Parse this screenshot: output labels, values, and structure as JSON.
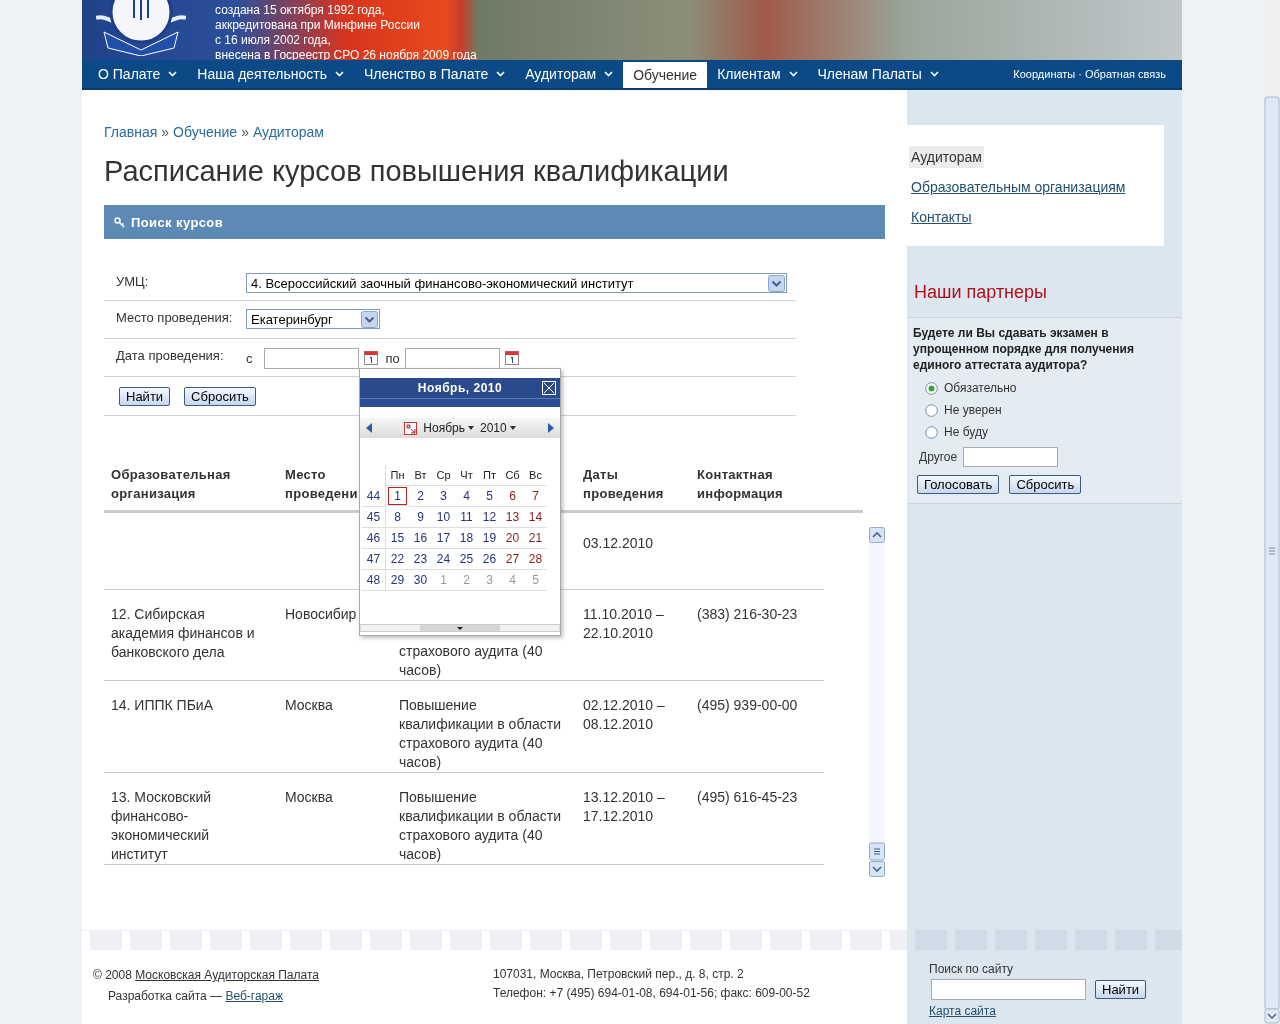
{
  "header": {
    "banner_lines": [
      "создана 15 октября 1992 года,",
      "аккредитована при Минфине России",
      "с 16 июля 2002 года,",
      "внесена в Госреестр СРО 26 ноября 2009 года"
    ]
  },
  "nav": {
    "items": [
      {
        "label": "О Палате",
        "selected": false,
        "dropdown": true
      },
      {
        "label": "Наша деятельность",
        "selected": false,
        "dropdown": true
      },
      {
        "label": "Членство в Палате",
        "selected": false,
        "dropdown": true
      },
      {
        "label": "Аудиторам",
        "selected": false,
        "dropdown": true
      },
      {
        "label": "Обучение",
        "selected": true,
        "dropdown": false
      },
      {
        "label": "Клиентам",
        "selected": false,
        "dropdown": true
      },
      {
        "label": "Членам Палаты",
        "selected": false,
        "dropdown": true
      }
    ],
    "links": [
      "Координаты",
      "Обратная связь"
    ],
    "separator": "·"
  },
  "breadcrumb": {
    "items": [
      "Главная",
      "Обучение",
      "Аудиторам"
    ],
    "separator": "»"
  },
  "title": "Расписание курсов повышения квалификации",
  "search_panel": {
    "title": "Поиск курсов",
    "fields": [
      {
        "kind": "select",
        "label": "УМЦ:",
        "value": "4. Всероссийский заочный финансово-экономический институт"
      },
      {
        "kind": "select",
        "label": "Место проведения:",
        "value": "Екатеринбург"
      },
      {
        "kind": "date_range",
        "label": "Дата проведения:",
        "from_label": "с",
        "to_label": "по"
      }
    ],
    "buttons": [
      "Найти",
      "Сбросить"
    ]
  },
  "calendar": {
    "title": "Ноябрь, 2010",
    "month": "Ноябрь",
    "year": "2010",
    "weekdays": [
      "Пн",
      "Вт",
      "Ср",
      "Чт",
      "Пт",
      "Сб",
      "Вс"
    ],
    "weeks": [
      {
        "number": "44",
        "days": [
          {
            "day": "1",
            "kind": "weekday",
            "selected": true
          },
          {
            "day": "2",
            "kind": "weekday",
            "selected": false
          },
          {
            "day": "3",
            "kind": "weekday",
            "selected": false
          },
          {
            "day": "4",
            "kind": "weekday",
            "selected": false
          },
          {
            "day": "5",
            "kind": "weekday",
            "selected": false
          },
          {
            "day": "6",
            "kind": "weekend",
            "selected": false
          },
          {
            "day": "7",
            "kind": "weekend",
            "selected": false
          }
        ]
      },
      {
        "number": "45",
        "days": [
          {
            "day": "8",
            "kind": "weekday",
            "selected": false
          },
          {
            "day": "9",
            "kind": "weekday",
            "selected": false
          },
          {
            "day": "10",
            "kind": "weekday",
            "selected": false
          },
          {
            "day": "11",
            "kind": "weekday",
            "selected": false
          },
          {
            "day": "12",
            "kind": "weekday",
            "selected": false
          },
          {
            "day": "13",
            "kind": "weekend",
            "selected": false
          },
          {
            "day": "14",
            "kind": "weekend",
            "selected": false
          }
        ]
      },
      {
        "number": "46",
        "days": [
          {
            "day": "15",
            "kind": "weekday",
            "selected": false
          },
          {
            "day": "16",
            "kind": "weekday",
            "selected": false
          },
          {
            "day": "17",
            "kind": "weekday",
            "selected": false
          },
          {
            "day": "18",
            "kind": "weekday",
            "selected": false
          },
          {
            "day": "19",
            "kind": "weekday",
            "selected": false
          },
          {
            "day": "20",
            "kind": "weekend",
            "selected": false
          },
          {
            "day": "21",
            "kind": "weekend",
            "selected": false
          }
        ]
      },
      {
        "number": "47",
        "days": [
          {
            "day": "22",
            "kind": "weekday",
            "selected": false
          },
          {
            "day": "23",
            "kind": "weekday",
            "selected": false
          },
          {
            "day": "24",
            "kind": "weekday",
            "selected": false
          },
          {
            "day": "25",
            "kind": "weekday",
            "selected": false
          },
          {
            "day": "26",
            "kind": "weekday",
            "selected": false
          },
          {
            "day": "27",
            "kind": "weekend",
            "selected": false
          },
          {
            "day": "28",
            "kind": "weekend",
            "selected": false
          }
        ]
      },
      {
        "number": "48",
        "days": [
          {
            "day": "29",
            "kind": "weekday",
            "selected": false
          },
          {
            "day": "30",
            "kind": "weekday",
            "selected": false
          },
          {
            "day": "1",
            "kind": "other",
            "selected": false
          },
          {
            "day": "2",
            "kind": "other",
            "selected": false
          },
          {
            "day": "3",
            "kind": "other",
            "selected": false
          },
          {
            "day": "4",
            "kind": "other",
            "selected": false
          },
          {
            "day": "5",
            "kind": "other",
            "selected": false
          }
        ]
      }
    ]
  },
  "table": {
    "columns": [
      {
        "label": "Образовательная организация"
      },
      {
        "label": "Место проведени"
      },
      {},
      {
        "label": "Даты проведения"
      },
      {
        "label": "Контактная информация"
      }
    ],
    "rows": [
      {
        "dates": "03.12.2010"
      },
      {
        "organization": "12. Сибирская академия финансов и банковского дела",
        "place": "Новосибир",
        "course": "страхового аудита (40 часов)",
        "course_clipped": true,
        "dates": "11.10.2010 – 22.10.2010",
        "contact": "(383) 216-30-23"
      },
      {
        "organization": "14. ИППК ПБиА",
        "place": "Москва",
        "course": "Повышение квалификации в области страхового аудита (40 часов)",
        "course_clipped": false,
        "dates": "02.12.2010 – 08.12.2010",
        "contact": "(495) 939-00-00"
      },
      {
        "organization": "13. Московский финансово-экономический институт",
        "place": "Москва",
        "course": "Повышение квалификации в области страхового аудита (40 часов)",
        "course_clipped": false,
        "dates": "13.12.2010 – 17.12.2010",
        "contact": "(495) 616-45-23"
      }
    ]
  },
  "sidebar": {
    "menu": [
      {
        "label": "Аудиторам",
        "selected": true
      },
      {
        "label": "Образовательным организациям",
        "selected": false
      },
      {
        "label": "Контакты",
        "selected": false
      }
    ],
    "partners_title": "Наши партнеры",
    "poll": {
      "question": "Будете ли Вы сдавать экзамен в упрощенном порядке для получения единого аттестата аудитора?",
      "options": [
        {
          "label": "Обязательно",
          "selected": true
        },
        {
          "label": "Не уверен",
          "selected": false
        },
        {
          "label": "Не буду",
          "selected": false
        }
      ],
      "other_label": "Другое",
      "buttons": [
        "Голосовать",
        "Сбросить"
      ]
    }
  },
  "footer": {
    "copyright": {
      "prefix": "© 2008",
      "link": "Московская Аудиторская Палата"
    },
    "credits": {
      "prefix": "Разработка сайта —",
      "link": "Веб-гараж"
    },
    "address": "107031, Москва, Петровский пер., д. 8, стр. 2",
    "phone": "Телефон: +7 (495) 694-01-08, 694-01-56; факс: 609-00-52",
    "search": {
      "label": "Поиск по сайту",
      "button": "Найти",
      "sitemap": "Карта сайта"
    }
  }
}
